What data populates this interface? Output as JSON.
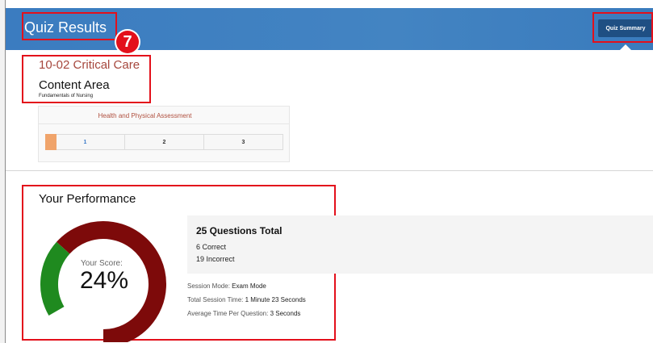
{
  "header": {
    "title": "Quiz Results",
    "step_badge": "7",
    "quiz_summary_button": "Quiz Summary"
  },
  "course": {
    "name": "10-02 Critical Care",
    "content_area_label": "Content Area",
    "content_area_value": "Fundamentals of Nursing"
  },
  "content_area_card": {
    "title": "Health and Physical Assessment",
    "segments": [
      "1",
      "2",
      "3"
    ]
  },
  "performance": {
    "title": "Your Performance",
    "score_label": "Your Score:",
    "score_value": "24%",
    "score_fraction": 0.24,
    "questions_total": "25 Questions Total",
    "correct": "6 Correct",
    "incorrect": "19 Incorrect",
    "session_mode_label": "Session Mode:",
    "session_mode_value": "Exam Mode",
    "total_time_label": "Total Session Time:",
    "total_time_value": "1 Minute 23 Seconds",
    "avg_time_label": "Average Time Per Question:",
    "avg_time_value": "3 Seconds"
  },
  "colors": {
    "header_blue": "#3d7fbd",
    "highlight_red": "#e3101b",
    "correct_green": "#1f8a1f",
    "incorrect_maroon": "#7d0a0a",
    "course_title": "#a6473d"
  }
}
